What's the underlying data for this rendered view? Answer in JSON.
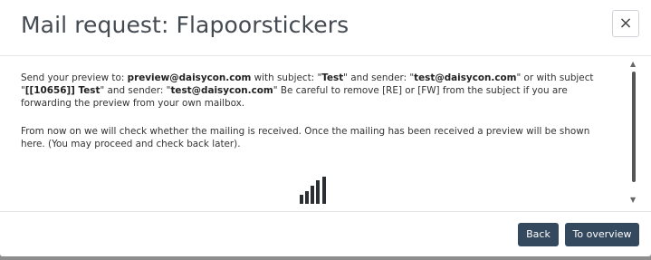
{
  "modal": {
    "title": "Mail request: Flapoorstickers",
    "close_label": "×"
  },
  "message": {
    "p1_prefix": "Send your preview to: ",
    "preview_email": "preview@daisycon.com",
    "p1_mid1": " with subject: \"",
    "subject1": "Test",
    "p1_mid2": "\" and sender: \"",
    "sender1": "test@daisycon.com",
    "p1_mid3": "\" or with subject \"",
    "subject2": "[[10656]] Test",
    "p1_mid4": "\" and sender: \"",
    "sender2": "test@daisycon.com",
    "p1_suffix": "\" Be careful to remove [RE] or [FW] from the subject if you are forwarding the preview from your own mailbox.",
    "p2": "From now on we will check whether the mailing is received. Once the mailing has been received a preview will be shown here. (You may proceed and check back later)."
  },
  "footer": {
    "back_label": "Back",
    "overview_label": "To overview"
  },
  "icons": {
    "loader": "loading-bars-icon",
    "scroll_up": "scroll-up-icon",
    "scroll_down": "scroll-down-icon"
  }
}
